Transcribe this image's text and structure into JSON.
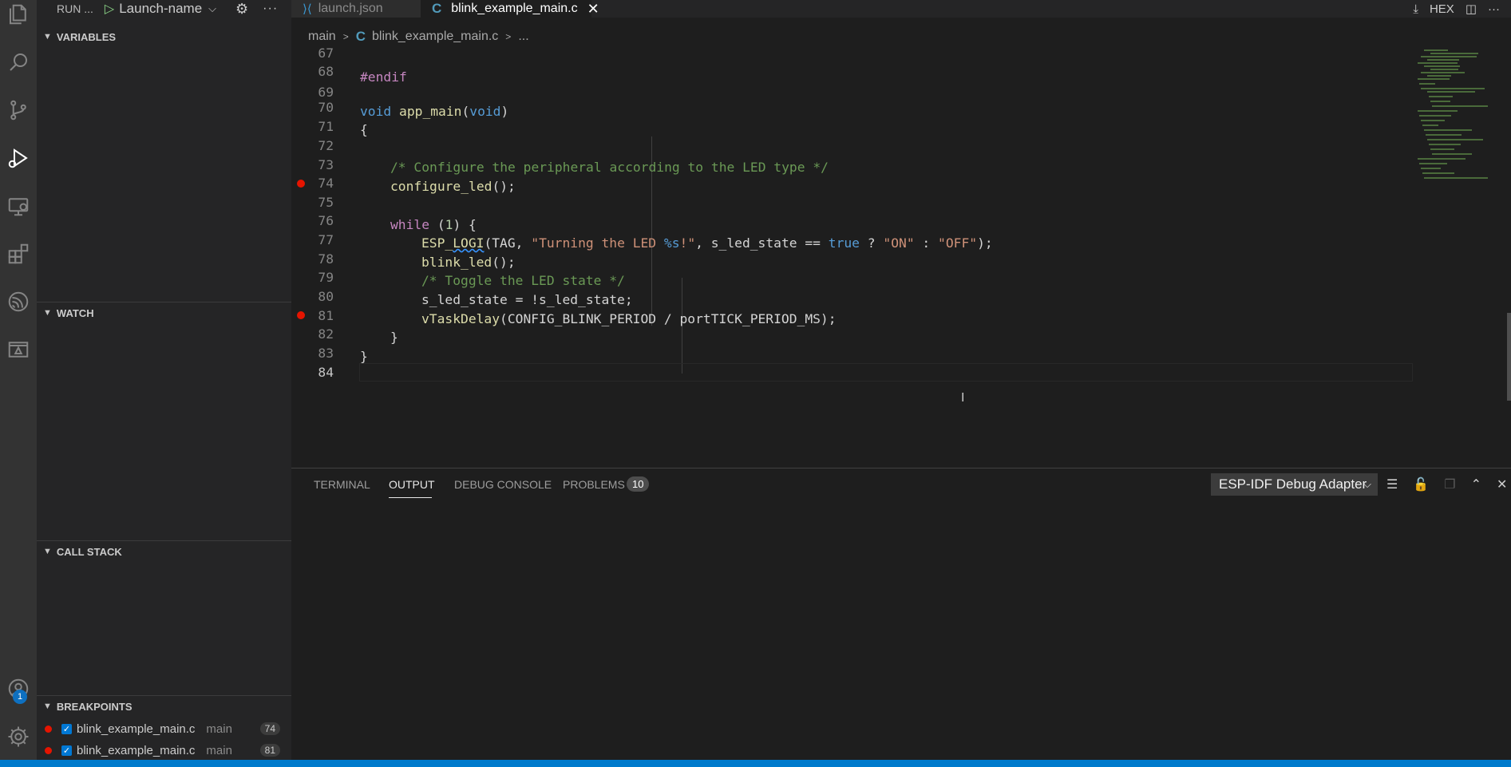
{
  "activity_bar": {
    "icons": [
      "explorer-icon",
      "search-icon",
      "source-control-icon",
      "run-debug-icon",
      "remote-explorer-icon",
      "extensions-icon",
      "espressif-icon",
      "eim-icon"
    ],
    "accounts_badge": "1"
  },
  "run": {
    "title": "RUN ...",
    "config": "Launch-name"
  },
  "sections": {
    "variables": "VARIABLES",
    "watch": "WATCH",
    "call_stack": "CALL STACK",
    "breakpoints": "BREAKPOINTS"
  },
  "breakpoints": [
    {
      "file": "blink_example_main.c",
      "func": "main",
      "line": "74"
    },
    {
      "file": "blink_example_main.c",
      "func": "main",
      "line": "81"
    }
  ],
  "tabs": [
    {
      "label": "launch.json",
      "active": false
    },
    {
      "label": "blink_example_main.c",
      "active": true
    }
  ],
  "top_tools": {
    "hex": "HEX"
  },
  "breadcrumb": {
    "folder": "main",
    "file": "blink_example_main.c",
    "symbol": "..."
  },
  "editor": {
    "line_numbers": [
      "67",
      "68",
      "69",
      "70",
      "71",
      "72",
      "73",
      "74",
      "75",
      "76",
      "77",
      "78",
      "79",
      "80",
      "81",
      "82",
      "83",
      "84"
    ],
    "breakpoint_lines": [
      "74",
      "81"
    ],
    "l68": "#endif",
    "l70a": "void",
    "l70b": "app_main",
    "l70c": "(",
    "l70d": "void",
    "l70e": ")",
    "l71": "{",
    "l73": "/* Configure the peripheral according to the LED type */",
    "l74a": "configure_led",
    "l74b": "();",
    "l76a": "while",
    "l76b": " (",
    "l76c": "1",
    "l76d": ") {",
    "l77a": "ESP_",
    "l77b": "LOGI",
    "l77c": "(TAG, ",
    "l77d": "\"Turning the LED ",
    "l77e": "%s",
    "l77f": "!\"",
    "l77g": ", s_led_state == ",
    "l77h": "true",
    "l77i": " ? ",
    "l77j": "\"ON\"",
    "l77k": " : ",
    "l77l": "\"OFF\"",
    "l77m": ");",
    "l78a": "blink_led",
    "l78b": "();",
    "l79": "/* Toggle the LED state */",
    "l80": "s_led_state = !s_led_state;",
    "l81a": "vTaskDelay",
    "l81b": "(CONFIG_BLINK_PERIOD / portTICK_PERIOD_MS);",
    "l82": "}",
    "l83": "}"
  },
  "panel": {
    "tabs": [
      "TERMINAL",
      "OUTPUT",
      "DEBUG CONSOLE",
      "PROBLEMS"
    ],
    "active_tab": "OUTPUT",
    "problems_count": "10",
    "output_channel": "ESP-IDF Debug Adapter"
  }
}
